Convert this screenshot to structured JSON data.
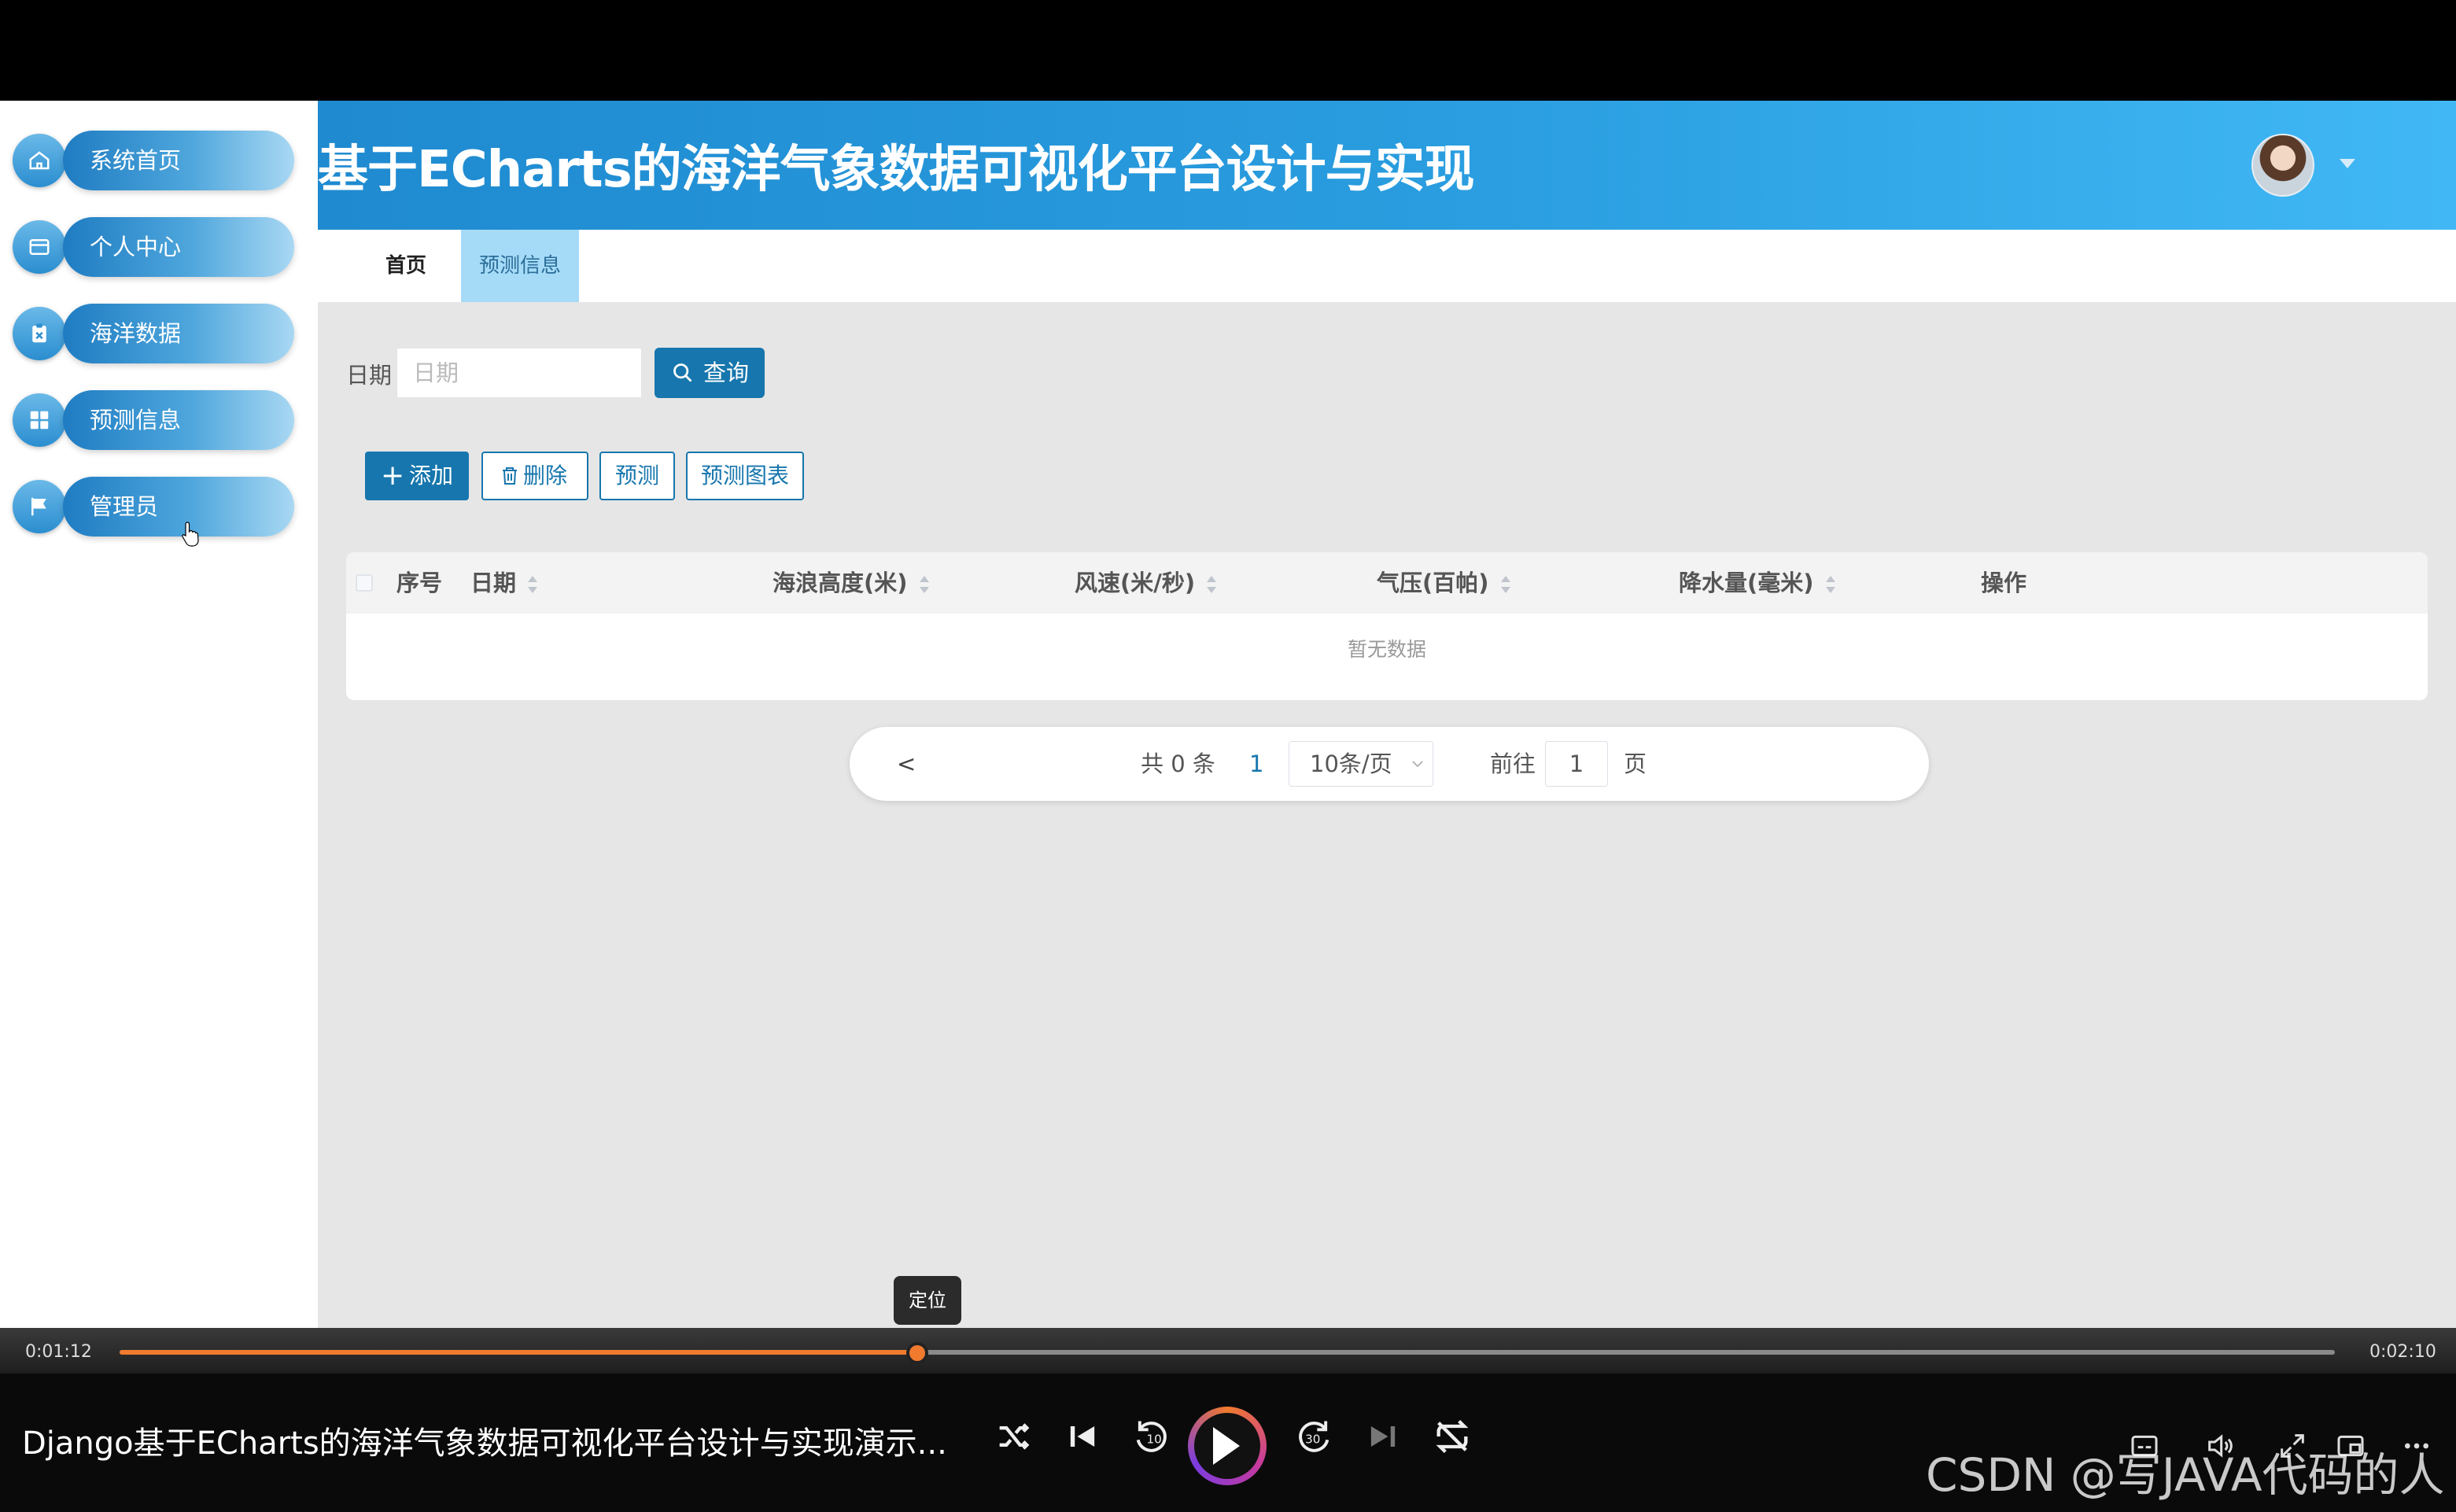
{
  "app": {
    "title": "基于ECharts的海洋气象数据可视化平台设计与实现"
  },
  "sidebar": {
    "items": [
      {
        "label": "系统首页",
        "icon": "home-icon"
      },
      {
        "label": "个人中心",
        "icon": "card-icon"
      },
      {
        "label": "海洋数据",
        "icon": "clipboard-icon"
      },
      {
        "label": "预测信息",
        "icon": "grid-icon"
      },
      {
        "label": "管理员",
        "icon": "flag-icon"
      }
    ]
  },
  "tabs": [
    {
      "label": "首页"
    },
    {
      "label": "预测信息"
    }
  ],
  "search": {
    "label": "日期",
    "placeholder": "日期",
    "query_label": "查询"
  },
  "toolbar": {
    "add_label": "添加",
    "delete_label": "删除",
    "predict_label": "预测",
    "chart_label": "预测图表"
  },
  "table": {
    "columns": [
      "序号",
      "日期",
      "海浪高度(米)",
      "风速(米/秒)",
      "气压(百帕)",
      "降水量(毫米)",
      "操作"
    ],
    "empty_text": "暂无数据"
  },
  "pagination": {
    "prev": "<",
    "total": "共 0 条",
    "current_page": "1",
    "page_size": "10条/页",
    "goto_label": "前往",
    "goto_value": "1",
    "page_suffix": "页"
  },
  "player": {
    "current_time": "0:01:12",
    "duration": "0:02:10",
    "progress": 0.36,
    "tooltip": "定位",
    "video_title": "Django基于ECharts的海洋气象数据可视化平台设计与实现演示...",
    "accent_color": "#f07a2e"
  },
  "watermark": "CSDN @写JAVA代码的人",
  "colors": {
    "primary": "#1676ad",
    "header_start": "#1f8ad0",
    "header_end": "#41b8f5",
    "active_tab": "#a6dbf8"
  }
}
